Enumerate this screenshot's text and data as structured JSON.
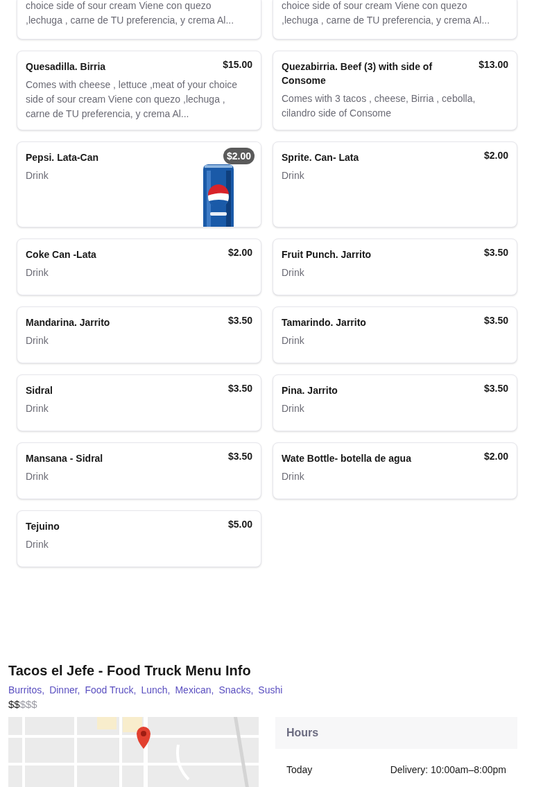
{
  "menu_items": [
    {
      "description": "choice side of sour cream Viene con quezo ,lechuga , carne de TU preferencia, y crema Al...",
      "kind": "partial"
    },
    {
      "description": "choice side of sour cream Viene con quezo ,lechuga , carne de TU preferencia, y crema Al...",
      "kind": "partial"
    },
    {
      "name": "Quesadilla. Birria",
      "price": "$15.00",
      "description": "Comes with cheese , lettuce ,meat of your choice side of sour cream Viene con quezo ,lechuga , carne de TU preferencia, y crema Al...",
      "kind": "text"
    },
    {
      "name": "Quezabirria. Beef (3) with side of Consome",
      "price": "$13.00",
      "description": "Comes with 3 tacos , cheese, Birria , cebolla, cilandro side of Consome",
      "kind": "text"
    },
    {
      "name": "Pepsi. Lata-Can",
      "price": "$2.00",
      "description": "Drink"
    },
    {
      "name": "Sprite. Can- Lata",
      "price": "$2.00",
      "description": "Drink",
      "kind": "text"
    },
    {
      "name": "Coke Can -Lata",
      "price": "$2.00",
      "description": "Drink",
      "kind": "text"
    },
    {
      "name": "Fruit Punch. Jarrito",
      "price": "$3.50",
      "description": "Drink",
      "kind": "text"
    },
    {
      "name": "Mandarina. Jarrito",
      "price": "$3.50",
      "description": "Drink",
      "kind": "text"
    },
    {
      "name": "Tamarindo. Jarrito",
      "price": "$3.50",
      "description": "Drink",
      "kind": "text"
    },
    {
      "name": "Sidral",
      "price": "$3.50",
      "description": "Drink",
      "kind": "text"
    },
    {
      "name": "Pina. Jarrito",
      "price": "$3.50",
      "description": "Drink",
      "kind": "text"
    },
    {
      "name": "Mansana - Sidral",
      "price": "$3.50",
      "description": "Drink",
      "kind": "text"
    },
    {
      "name": "Wate Bottle- botella de agua",
      "price": "$2.00",
      "description": "Drink",
      "kind": "text"
    },
    {
      "name": "Tejuino",
      "price": "$5.00",
      "description": "Drink",
      "kind": "text"
    }
  ],
  "info": {
    "title": "Tacos el Jefe - Food Truck Menu Info",
    "categories": [
      "Burritos,",
      "Dinner,",
      "Food Truck,",
      "Lunch,",
      "Mexican,",
      "Snacks,",
      "Sushi"
    ],
    "price_range": {
      "active": "$$",
      "inactive": "$$$"
    },
    "hours": {
      "title": "Hours",
      "rows": [
        {
          "day": "Today",
          "times": "Delivery: 10:00am–8:00pm"
        }
      ]
    }
  }
}
